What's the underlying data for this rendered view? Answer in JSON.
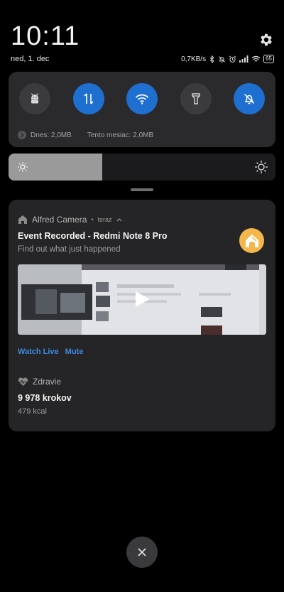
{
  "status": {
    "time": "10:11",
    "date": "ned, 1. dec",
    "net_speed": "0,7KB/s",
    "battery": "65"
  },
  "quick_settings": {
    "tiles": [
      {
        "icon": "android-debug-icon",
        "active": false
      },
      {
        "icon": "mobile-data-icon",
        "active": true
      },
      {
        "icon": "wifi-icon",
        "active": true
      },
      {
        "icon": "flashlight-icon",
        "active": false
      },
      {
        "icon": "bell-off-icon",
        "active": true
      }
    ],
    "data_today": "Dnes: 2,0MB",
    "data_month": "Tento mesiac: 2,0MB"
  },
  "brightness": {
    "level_percent": 35
  },
  "notification": {
    "app_name": "Alfred Camera",
    "time": "teraz",
    "title": "Event Recorded - Redmi Note 8 Pro",
    "subtitle": "Find out what just happened",
    "actions": [
      "Watch Live",
      "Mute"
    ],
    "accent": "#f5b74c"
  },
  "health": {
    "app_name": "Zdravie",
    "steps": "9 978 krokov",
    "kcal": "479 kcal"
  },
  "colors": {
    "active_tile": "#1f6fd1",
    "action_link": "#3d8be0"
  }
}
